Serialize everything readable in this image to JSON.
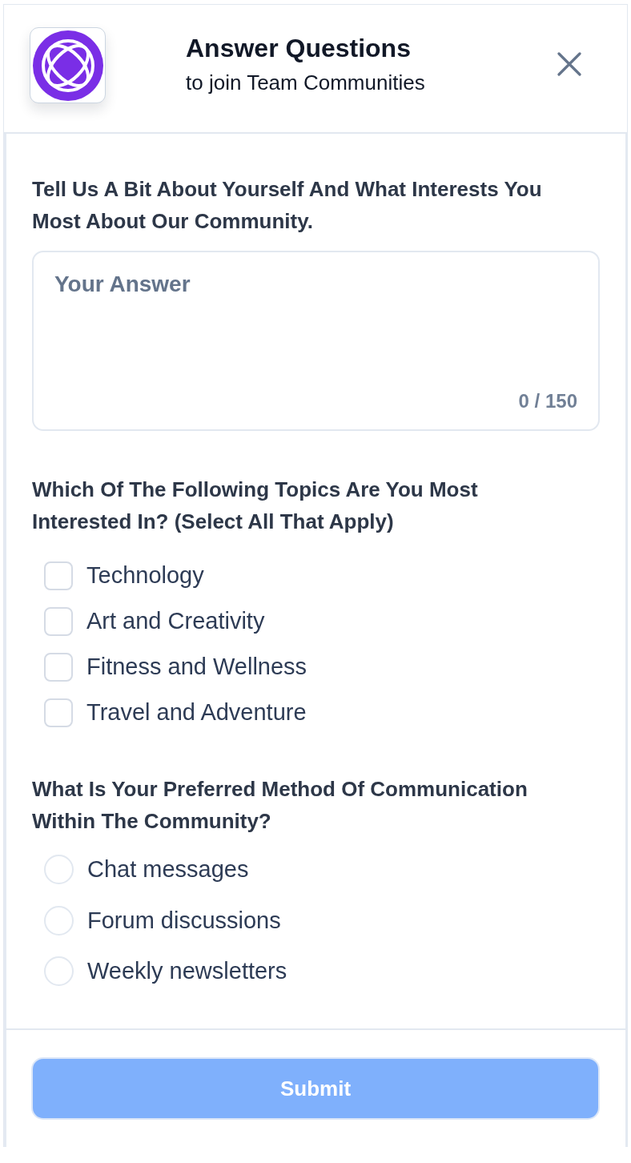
{
  "header": {
    "title": "Answer Questions",
    "subtitle": "to join Team Communities"
  },
  "questions": [
    {
      "kind": "text",
      "prompt": "Tell Us A Bit About Yourself And What Interests You Most About Our Community.",
      "placeholder": "Your Answer",
      "counter": "0 / 150"
    },
    {
      "kind": "checkbox",
      "prompt": "Which Of The Following Topics Are You Most Interested In? (Select All That Apply)",
      "options": [
        {
          "label": "Technology",
          "checked": false
        },
        {
          "label": "Art and Creativity",
          "checked": false
        },
        {
          "label": "Fitness and Wellness",
          "checked": false
        },
        {
          "label": "Travel and Adventure",
          "checked": false
        }
      ]
    },
    {
      "kind": "radio",
      "prompt": "What Is Your Preferred Method Of Communication Within The Community?",
      "options": [
        {
          "label": "Chat messages",
          "selected": false
        },
        {
          "label": "Forum discussions",
          "selected": false
        },
        {
          "label": "Weekly newsletters",
          "selected": false
        }
      ]
    }
  ],
  "submit": {
    "label": "Submit",
    "disabled": true
  }
}
